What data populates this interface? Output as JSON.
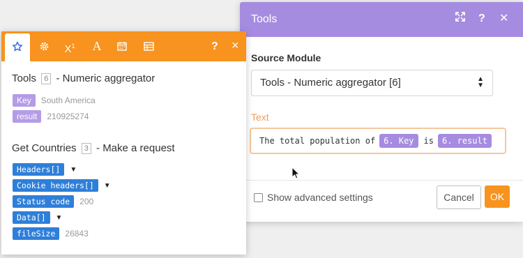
{
  "dialog": {
    "title": "Tools",
    "source_module_label": "Source Module",
    "source_module_value": "Tools - Numeric aggregator [6]",
    "text_label": "Text",
    "text_field": {
      "prefix": "The total population of",
      "pill1": "6. Key",
      "middle": "is",
      "pill2": "6. result"
    },
    "advanced_label": "Show advanced settings",
    "advanced_checked": false,
    "cancel_label": "Cancel",
    "ok_label": "OK",
    "header_color": "#a68ce0"
  },
  "panel": {
    "accent_color": "#f7931e",
    "tabs": [
      "star-icon",
      "gear-icon",
      "superscript-icon",
      "text-icon",
      "calendar-icon",
      "table-icon"
    ],
    "help_label": "?",
    "close_label": "×",
    "modules": [
      {
        "name": "Tools",
        "number": "6",
        "type": "Numeric aggregator",
        "items": [
          {
            "key": "Key",
            "value": "South America"
          },
          {
            "key": "result",
            "value": "210925274"
          }
        ]
      },
      {
        "name": "Get Countries",
        "number": "3",
        "type": "Make a request",
        "items": [
          {
            "key": "Headers[]",
            "value": "",
            "expandable": true
          },
          {
            "key": "Cookie headers[]",
            "value": "",
            "expandable": true
          },
          {
            "key": "Status code",
            "value": "200"
          },
          {
            "key": "Data[]",
            "value": "",
            "expandable": true
          },
          {
            "key": "fileSize",
            "value": "26843"
          }
        ]
      }
    ]
  }
}
